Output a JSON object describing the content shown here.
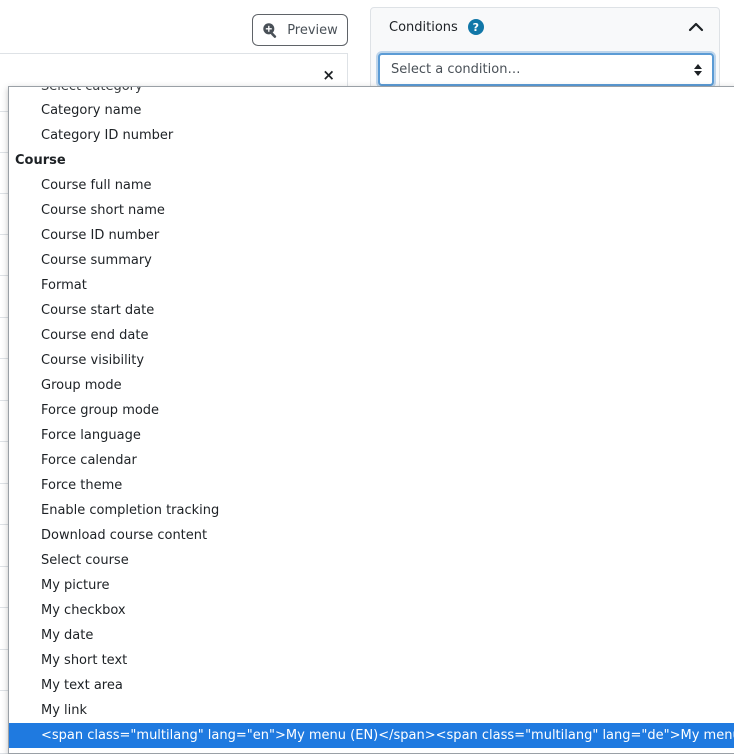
{
  "toolbar": {
    "preview_label": "Preview",
    "preview_icon": "zoom-in-icon"
  },
  "report_panel": {
    "close_glyph": "×"
  },
  "conditions": {
    "title": "Conditions",
    "help_glyph": "?",
    "select_placeholder": "Select a condition…",
    "accent_color": "#1177a8"
  },
  "dropdown": {
    "top_partial_item": "Select category",
    "items_before_group": [
      "Category name",
      "Category ID number"
    ],
    "group_label": "Course",
    "group_items": [
      "Course full name",
      "Course short name",
      "Course ID number",
      "Course summary",
      "Format",
      "Course start date",
      "Course end date",
      "Course visibility",
      "Group mode",
      "Force group mode",
      "Force language",
      "Force calendar",
      "Force theme",
      "Enable completion tracking",
      "Download course content",
      "Select course",
      "My picture",
      "My checkbox",
      "My date",
      "My short text",
      "My text area",
      "My link"
    ],
    "selected_item": "<span class=\"multilang\" lang=\"en\">My menu (EN)</span><span class=\"multilang\" lang=\"de\">My menu (DE)</span>",
    "selected_color": "#1f7ae0"
  }
}
